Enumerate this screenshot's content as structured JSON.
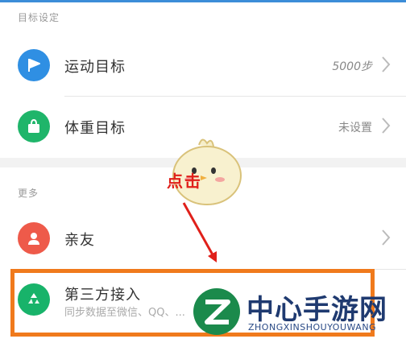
{
  "sections": {
    "goals_label": "目标设定",
    "more_label": "更多"
  },
  "rows": {
    "exercise": {
      "title": "运动目标",
      "value": "5000步",
      "icon": "flag-icon",
      "color": "#2f8fe3"
    },
    "weight": {
      "title": "体重目标",
      "value": "未设置",
      "icon": "bag-icon",
      "color": "#1fb56a"
    },
    "friends": {
      "title": "亲友",
      "icon": "person-icon",
      "color": "#ee5a4a"
    },
    "thirdparty": {
      "title": "第三方接入",
      "subtitle": "同步数据至微信、QQ、...",
      "icon": "recycle-icon",
      "color": "#18b36a"
    }
  },
  "annotation": {
    "text": "点击",
    "color": "#e0201a"
  },
  "watermark": {
    "text": "中心手游网",
    "sub": "ZHONGXINSHOUYOUWANG"
  }
}
